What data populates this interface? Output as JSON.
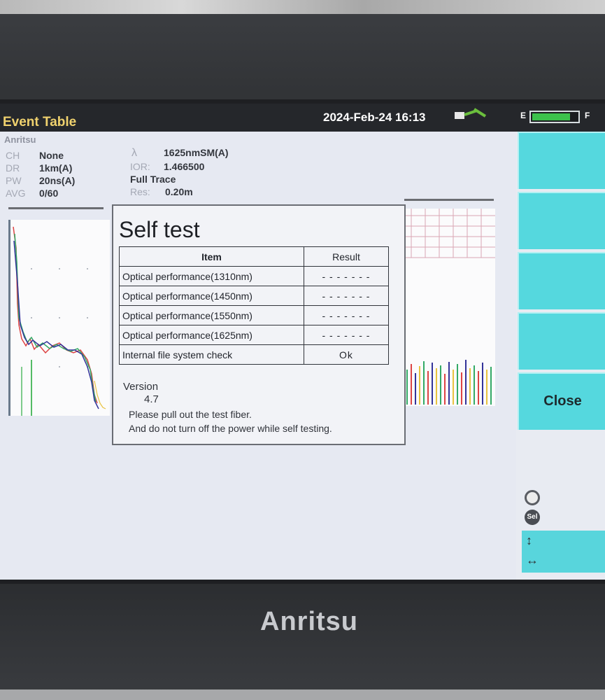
{
  "statusbar": {
    "title": "Event Table",
    "datetime": "2024-Feb-24 16:13",
    "battery_empty_label": "E",
    "battery_full_label": "F",
    "battery_level": 0.85
  },
  "brand_small": "Anritsu",
  "params_left": [
    {
      "label": "CH",
      "value": "None"
    },
    {
      "label": "DR",
      "value": "1km(A)"
    },
    {
      "label": "PW",
      "value": "20ns(A)"
    },
    {
      "label": "AVG",
      "value": "0/60"
    }
  ],
  "params_right": {
    "lambda_symbol": "λ",
    "lambda_value": "1625nmSM(A)",
    "ior_label": "IOR:",
    "ior_value": "1.466500",
    "trace": "Full Trace",
    "res_label": "Res:",
    "res_value": "0.20m"
  },
  "dialog": {
    "title": "Self test",
    "headers": {
      "item": "Item",
      "result": "Result"
    },
    "rows": [
      {
        "item": "Optical performance(1310nm)",
        "result": "- - - - - - -"
      },
      {
        "item": "Optical performance(1450nm)",
        "result": "- - - - - - -"
      },
      {
        "item": "Optical performance(1550nm)",
        "result": "- - - - - - -"
      },
      {
        "item": "Optical performance(1625nm)",
        "result": "- - - - - - -"
      },
      {
        "item": "Internal file system check",
        "result": "Ok"
      }
    ],
    "version_label": "Version",
    "version_value": "4.7",
    "message_1": "Please pull out the test fiber.",
    "message_2": "And do not turn off the power while self testing."
  },
  "softkeys": {
    "close_label": "Close"
  },
  "knob": {
    "sel_label": "Sel",
    "updown_arrow": "↕",
    "leftright_arrow": "↔"
  },
  "bezel_logo": "Anritsu",
  "colors": {
    "softkey": "#55d8de",
    "title": "#f0d26e",
    "battery": "#3cc24c"
  }
}
